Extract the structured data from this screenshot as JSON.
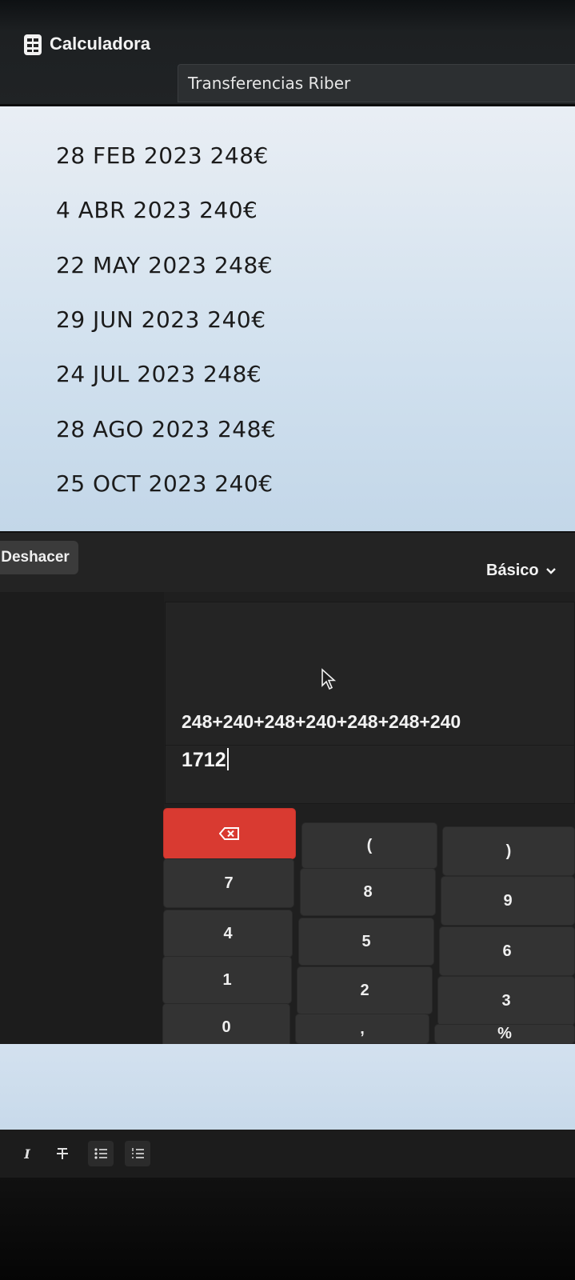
{
  "window": {
    "app_title": "Calculadora",
    "document_tab": "Transferencias Riber"
  },
  "note": {
    "lines": [
      "28 FEB 2023 248€",
      "4 ABR 2023 240€",
      "22 MAY 2023 248€",
      "29 JUN 2023 240€",
      "24 JUL 2023 248€",
      "28 AGO 2023 248€",
      "25 OCT 2023 240€"
    ]
  },
  "calculator": {
    "undo_label": "Deshacer",
    "mode_label": "Básico",
    "expression": "248+240+248+240+248+248+240",
    "result": "1712",
    "keys": {
      "backspace_icon": "backspace-icon",
      "paren_open": "(",
      "paren_close": ")",
      "seven": "7",
      "eight": "8",
      "nine": "9",
      "four": "4",
      "five": "5",
      "six": "6",
      "one": "1",
      "two": "2",
      "three": "3",
      "zero": "0",
      "decimal": ",",
      "percent": "%"
    },
    "colors": {
      "backspace_key": "#d93a31",
      "key": "#333333",
      "display": "#242424"
    }
  },
  "toolbar": {
    "items": [
      "italic-icon",
      "strikethrough-icon",
      "bullet-list-icon",
      "numbered-list-icon"
    ]
  }
}
